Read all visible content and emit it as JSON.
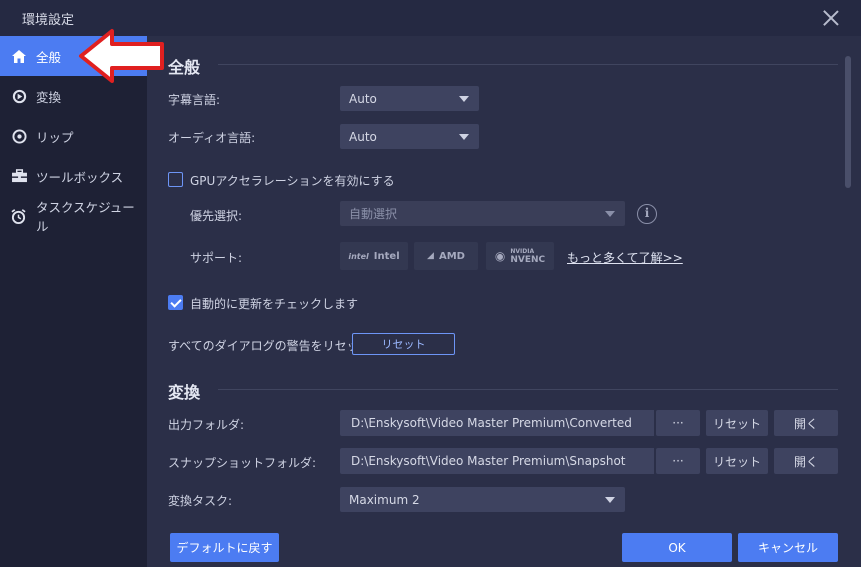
{
  "window": {
    "title": "環境設定"
  },
  "sidebar": {
    "items": [
      {
        "label": "全般",
        "icon": "home-icon",
        "active": true
      },
      {
        "label": "変換",
        "icon": "convert-icon",
        "active": false
      },
      {
        "label": "リップ",
        "icon": "disc-icon",
        "active": false
      },
      {
        "label": "ツールボックス",
        "icon": "toolbox-icon",
        "active": false
      },
      {
        "label": "タスクスケジュール",
        "icon": "alarm-clock-icon",
        "active": false
      }
    ]
  },
  "general": {
    "title": "全般",
    "subtitle_lang_label": "字幕言語:",
    "subtitle_lang_value": "Auto",
    "audio_lang_label": "オーディオ言語:",
    "audio_lang_value": "Auto",
    "gpu_checkbox_label": "GPUアクセラレーションを有効にする",
    "gpu_checked": false,
    "priority_label": "優先選択:",
    "priority_value": "自動選択",
    "support_label": "サポート:",
    "support_badges": [
      {
        "name": "intel",
        "label": "Intel",
        "glyph": "intel"
      },
      {
        "name": "amd",
        "label": "AMD",
        "glyph": "◢"
      },
      {
        "name": "nvidia",
        "label_top": "NVIDIA",
        "label": "NVENC",
        "glyph": "◉"
      }
    ],
    "learn_more": "もっと多くて了解>>",
    "auto_update_label": "自動的に更新をチェックします",
    "auto_update_checked": true,
    "reset_dialogs_label": "すべてのダイアログの警告をリセット:",
    "reset_button": "リセット"
  },
  "convert": {
    "title": "変換",
    "output_folder_label": "出力フォルダ:",
    "output_folder_path": "D:\\Enskysoft\\Video Master Premium\\Converted",
    "snapshot_folder_label": "スナップショットフォルダ:",
    "snapshot_folder_path": "D:\\Enskysoft\\Video Master Premium\\Snapshot",
    "more_button": "···",
    "reset_button": "リセット",
    "open_button": "開く",
    "tasks_label": "変換タスク:",
    "tasks_value": "Maximum 2"
  },
  "footer": {
    "default_button": "デフォルトに戻す",
    "ok_button": "OK",
    "cancel_button": "キャンセル"
  },
  "colors": {
    "accent": "#4c7cf2",
    "annotation_arrow": "#e02020"
  }
}
